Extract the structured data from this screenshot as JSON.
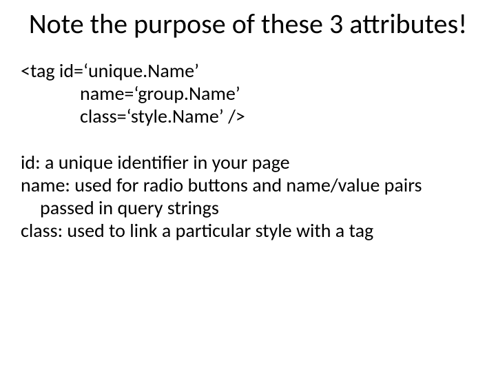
{
  "title": "Note the purpose of these 3 attributes!",
  "code": {
    "line1": "<tag   id=‘unique.Name’",
    "line2": "name=‘group.Name’",
    "line3": "class=‘style.Name’  />"
  },
  "definitions": {
    "id": "id:  a unique identifier in your page",
    "name": "name: used for radio buttons and name/value pairs passed in query strings",
    "class": "class: used to link a particular style with a tag"
  }
}
